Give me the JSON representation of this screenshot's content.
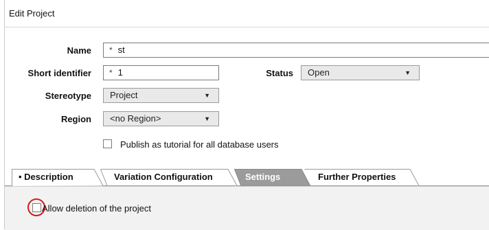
{
  "window": {
    "title": "Edit Project"
  },
  "form": {
    "name": {
      "label": "Name",
      "required_mark": "*",
      "value": "st"
    },
    "short_identifier": {
      "label": "Short identifier",
      "required_mark": "*",
      "value": "1"
    },
    "status": {
      "label": "Status",
      "value": "Open"
    },
    "stereotype": {
      "label": "Stereotype",
      "value": "Project"
    },
    "region": {
      "label": "Region",
      "value": "<no Region>"
    },
    "publish_tutorial": {
      "label": "Publish as tutorial for all database users",
      "checked": false
    }
  },
  "tabs": [
    {
      "label": "• Description",
      "active": false
    },
    {
      "label": "Variation Configuration",
      "active": false
    },
    {
      "label": "Settings",
      "active": true
    },
    {
      "label": "Further Properties",
      "active": false
    }
  ],
  "settings": {
    "allow_deletion": {
      "label": "Allow deletion of the project",
      "checked": false
    }
  },
  "icons": {
    "dropdown_arrow": "▼"
  },
  "colors": {
    "active_tab": "#9b9b9b",
    "highlight_ring": "#d11c1c"
  }
}
